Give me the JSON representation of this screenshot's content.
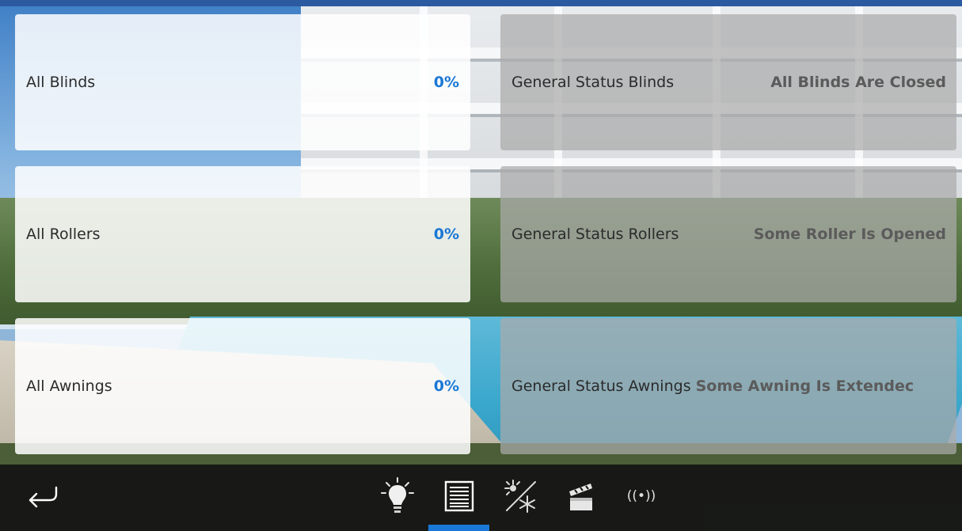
{
  "cards": [
    {
      "label": "All Blinds",
      "value": "0%"
    },
    {
      "label": "All Rollers",
      "value": "0%"
    },
    {
      "label": "All Awnings",
      "value": "0%"
    }
  ],
  "status_cards": [
    {
      "label": "General Status Blinds",
      "status": "All Blinds Are Closed"
    },
    {
      "label": "General Status Rollers",
      "status": "Some Roller Is Opened"
    },
    {
      "label": "General Status Awnings",
      "status": "Some Awning Is Extendec"
    }
  ],
  "bottom_nav": {
    "back_icon": "back-arrow-icon",
    "items": [
      {
        "icon": "lightbulb-icon"
      },
      {
        "icon": "blinds-icon",
        "active": true
      },
      {
        "icon": "climate-icon"
      },
      {
        "icon": "scene-clapperboard-icon"
      },
      {
        "icon": "wireless-signal-icon",
        "text": "((•))"
      }
    ]
  },
  "colors": {
    "accent": "#1a78d6",
    "bar_background": "#141414"
  }
}
